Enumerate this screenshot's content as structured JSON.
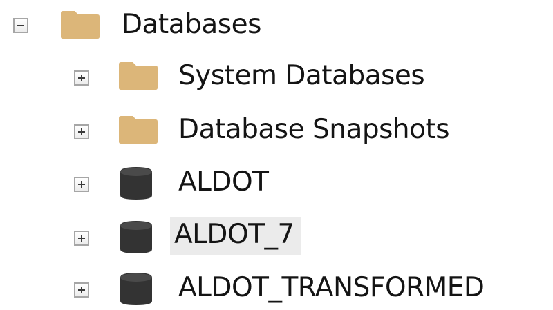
{
  "tree": {
    "root": {
      "label": "Databases",
      "icon": "folder-icon",
      "expanded": true
    },
    "children": [
      {
        "label": "System Databases",
        "icon": "folder-icon",
        "expanded": false
      },
      {
        "label": "Database Snapshots",
        "icon": "folder-icon",
        "expanded": false
      },
      {
        "label": "ALDOT",
        "icon": "database-icon",
        "expanded": false
      },
      {
        "label": "ALDOT_7",
        "icon": "database-icon",
        "expanded": false,
        "hovered": true
      },
      {
        "label": "ALDOT_TRANSFORMED",
        "icon": "database-icon",
        "expanded": false
      }
    ]
  },
  "colors": {
    "folder": "#dcb679",
    "database": "#333333",
    "hover_background": "#ebebeb",
    "toggle_border": "#a6a6a6"
  }
}
